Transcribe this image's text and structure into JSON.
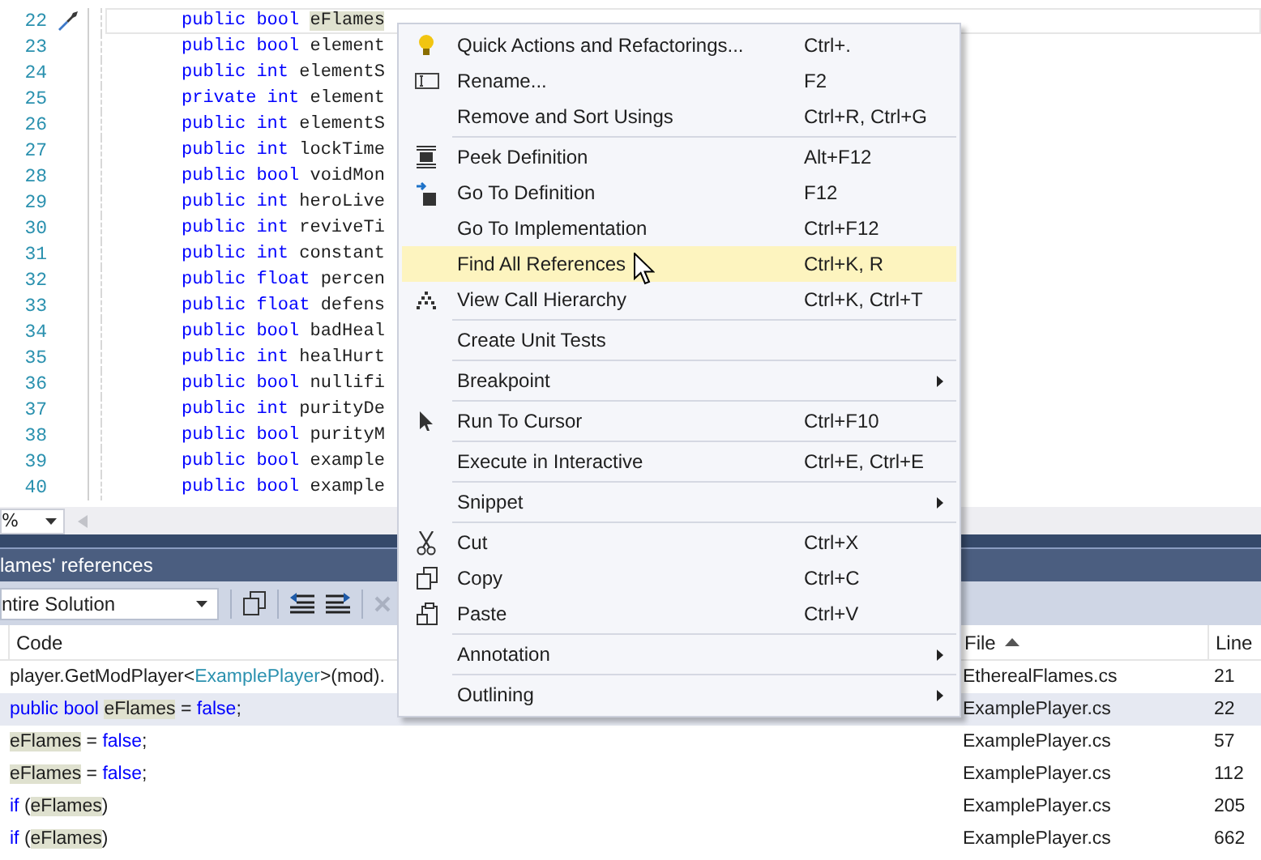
{
  "editor": {
    "lines": [
      {
        "number": "22",
        "current": true,
        "tokens": [
          {
            "kind": "keyword",
            "text": "public bool "
          },
          {
            "kind": "match",
            "text": "eFlames"
          }
        ]
      },
      {
        "number": "23",
        "current": false,
        "tokens": [
          {
            "kind": "keyword",
            "text": "public bool "
          },
          {
            "kind": "plain",
            "text": "element"
          }
        ]
      },
      {
        "number": "24",
        "current": false,
        "tokens": [
          {
            "kind": "keyword",
            "text": "public int "
          },
          {
            "kind": "plain",
            "text": "elementS"
          }
        ]
      },
      {
        "number": "25",
        "current": false,
        "tokens": [
          {
            "kind": "keyword",
            "text": "private int "
          },
          {
            "kind": "plain",
            "text": "element"
          }
        ]
      },
      {
        "number": "26",
        "current": false,
        "tokens": [
          {
            "kind": "keyword",
            "text": "public int "
          },
          {
            "kind": "plain",
            "text": "elementS"
          }
        ]
      },
      {
        "number": "27",
        "current": false,
        "tokens": [
          {
            "kind": "keyword",
            "text": "public int "
          },
          {
            "kind": "plain",
            "text": "lockTime"
          }
        ]
      },
      {
        "number": "28",
        "current": false,
        "tokens": [
          {
            "kind": "keyword",
            "text": "public bool "
          },
          {
            "kind": "plain",
            "text": "voidMon"
          }
        ]
      },
      {
        "number": "29",
        "current": false,
        "tokens": [
          {
            "kind": "keyword",
            "text": "public int "
          },
          {
            "kind": "plain",
            "text": "heroLive"
          }
        ]
      },
      {
        "number": "30",
        "current": false,
        "tokens": [
          {
            "kind": "keyword",
            "text": "public int "
          },
          {
            "kind": "plain",
            "text": "reviveTi"
          }
        ]
      },
      {
        "number": "31",
        "current": false,
        "tokens": [
          {
            "kind": "keyword",
            "text": "public int "
          },
          {
            "kind": "plain",
            "text": "constant"
          }
        ]
      },
      {
        "number": "32",
        "current": false,
        "tokens": [
          {
            "kind": "keyword",
            "text": "public float "
          },
          {
            "kind": "plain",
            "text": "percen"
          }
        ]
      },
      {
        "number": "33",
        "current": false,
        "tokens": [
          {
            "kind": "keyword",
            "text": "public float "
          },
          {
            "kind": "plain",
            "text": "defens"
          }
        ]
      },
      {
        "number": "34",
        "current": false,
        "tokens": [
          {
            "kind": "keyword",
            "text": "public bool "
          },
          {
            "kind": "plain",
            "text": "badHeal"
          }
        ]
      },
      {
        "number": "35",
        "current": false,
        "tokens": [
          {
            "kind": "keyword",
            "text": "public int "
          },
          {
            "kind": "plain",
            "text": "healHurt"
          }
        ]
      },
      {
        "number": "36",
        "current": false,
        "tokens": [
          {
            "kind": "keyword",
            "text": "public bool "
          },
          {
            "kind": "plain",
            "text": "nullifi"
          }
        ]
      },
      {
        "number": "37",
        "current": false,
        "tokens": [
          {
            "kind": "keyword",
            "text": "public int "
          },
          {
            "kind": "plain",
            "text": "purityDe"
          }
        ]
      },
      {
        "number": "38",
        "current": false,
        "tokens": [
          {
            "kind": "keyword",
            "text": "public bool "
          },
          {
            "kind": "plain",
            "text": "purityM"
          }
        ]
      },
      {
        "number": "39",
        "current": false,
        "tokens": [
          {
            "kind": "keyword",
            "text": "public bool "
          },
          {
            "kind": "plain",
            "text": "example"
          }
        ]
      },
      {
        "number": "40",
        "current": false,
        "tokens": [
          {
            "kind": "keyword",
            "text": "public bool "
          },
          {
            "kind": "plain",
            "text": "example"
          }
        ]
      }
    ],
    "zoom": "%"
  },
  "references_panel": {
    "title": "lames' references",
    "scope": "ntire Solution",
    "columns": [
      {
        "label": "Code"
      },
      {
        "label": "File",
        "sorted": true
      },
      {
        "label": "Line"
      }
    ],
    "rows": [
      {
        "selected": false,
        "code": [
          {
            "kind": "plain",
            "text": "player.GetModPlayer<"
          },
          {
            "kind": "type",
            "text": "ExamplePlayer"
          },
          {
            "kind": "plain",
            "text": ">(mod)."
          }
        ],
        "file": "EtherealFlames.cs",
        "line": "21"
      },
      {
        "selected": true,
        "code": [
          {
            "kind": "keyword",
            "text": "public bool "
          },
          {
            "kind": "match",
            "text": "eFlames"
          },
          {
            "kind": "plain",
            "text": " = "
          },
          {
            "kind": "keyword",
            "text": "false"
          },
          {
            "kind": "plain",
            "text": ";"
          }
        ],
        "file": "ExamplePlayer.cs",
        "line": "22"
      },
      {
        "selected": false,
        "code": [
          {
            "kind": "match",
            "text": "eFlames"
          },
          {
            "kind": "plain",
            "text": " = "
          },
          {
            "kind": "keyword",
            "text": "false"
          },
          {
            "kind": "plain",
            "text": ";"
          }
        ],
        "file": "ExamplePlayer.cs",
        "line": "57"
      },
      {
        "selected": false,
        "code": [
          {
            "kind": "match",
            "text": "eFlames"
          },
          {
            "kind": "plain",
            "text": " = "
          },
          {
            "kind": "keyword",
            "text": "false"
          },
          {
            "kind": "plain",
            "text": ";"
          }
        ],
        "file": "ExamplePlayer.cs",
        "line": "112"
      },
      {
        "selected": false,
        "code": [
          {
            "kind": "keyword",
            "text": "if"
          },
          {
            "kind": "plain",
            "text": " ("
          },
          {
            "kind": "match",
            "text": "eFlames"
          },
          {
            "kind": "plain",
            "text": ")"
          }
        ],
        "file": "ExamplePlayer.cs",
        "line": "205"
      },
      {
        "selected": false,
        "code": [
          {
            "kind": "keyword",
            "text": "if"
          },
          {
            "kind": "plain",
            "text": " ("
          },
          {
            "kind": "match",
            "text": "eFlames"
          },
          {
            "kind": "plain",
            "text": ")"
          }
        ],
        "file": "ExamplePlayer.cs",
        "line": "662"
      }
    ]
  },
  "context_menu": {
    "items": [
      {
        "kind": "item",
        "label": "Quick Actions and Refactorings...",
        "shortcut": "Ctrl+.",
        "highlighted": false,
        "submenu": false
      },
      {
        "kind": "item",
        "label": "Rename...",
        "shortcut": "F2",
        "highlighted": false,
        "submenu": false
      },
      {
        "kind": "item",
        "label": "Remove and Sort Usings",
        "shortcut": "Ctrl+R, Ctrl+G",
        "highlighted": false,
        "submenu": false
      },
      {
        "kind": "separator"
      },
      {
        "kind": "item",
        "label": "Peek Definition",
        "shortcut": "Alt+F12",
        "highlighted": false,
        "submenu": false
      },
      {
        "kind": "item",
        "label": "Go To Definition",
        "shortcut": "F12",
        "highlighted": false,
        "submenu": false
      },
      {
        "kind": "item",
        "label": "Go To Implementation",
        "shortcut": "Ctrl+F12",
        "highlighted": false,
        "submenu": false
      },
      {
        "kind": "item",
        "label": "Find All References",
        "shortcut": "Ctrl+K, R",
        "highlighted": true,
        "submenu": false
      },
      {
        "kind": "item",
        "label": "View Call Hierarchy",
        "shortcut": "Ctrl+K, Ctrl+T",
        "highlighted": false,
        "submenu": false
      },
      {
        "kind": "separator"
      },
      {
        "kind": "item",
        "label": "Create Unit Tests",
        "highlighted": false,
        "submenu": false
      },
      {
        "kind": "separator"
      },
      {
        "kind": "item",
        "label": "Breakpoint",
        "highlighted": false,
        "submenu": true
      },
      {
        "kind": "separator"
      },
      {
        "kind": "item",
        "label": "Run To Cursor",
        "shortcut": "Ctrl+F10",
        "highlighted": false,
        "submenu": false
      },
      {
        "kind": "separator"
      },
      {
        "kind": "item",
        "label": "Execute in Interactive",
        "shortcut": "Ctrl+E, Ctrl+E",
        "highlighted": false,
        "submenu": false
      },
      {
        "kind": "separator"
      },
      {
        "kind": "item",
        "label": "Snippet",
        "highlighted": false,
        "submenu": true
      },
      {
        "kind": "separator"
      },
      {
        "kind": "item",
        "label": "Cut",
        "shortcut": "Ctrl+X",
        "highlighted": false,
        "submenu": false
      },
      {
        "kind": "item",
        "label": "Copy",
        "shortcut": "Ctrl+C",
        "highlighted": false,
        "submenu": false
      },
      {
        "kind": "item",
        "label": "Paste",
        "shortcut": "Ctrl+V",
        "highlighted": false,
        "submenu": false
      },
      {
        "kind": "separator"
      },
      {
        "kind": "item",
        "label": "Annotation",
        "highlighted": false,
        "submenu": true
      },
      {
        "kind": "separator"
      },
      {
        "kind": "item",
        "label": "Outlining",
        "highlighted": false,
        "submenu": true
      }
    ]
  }
}
